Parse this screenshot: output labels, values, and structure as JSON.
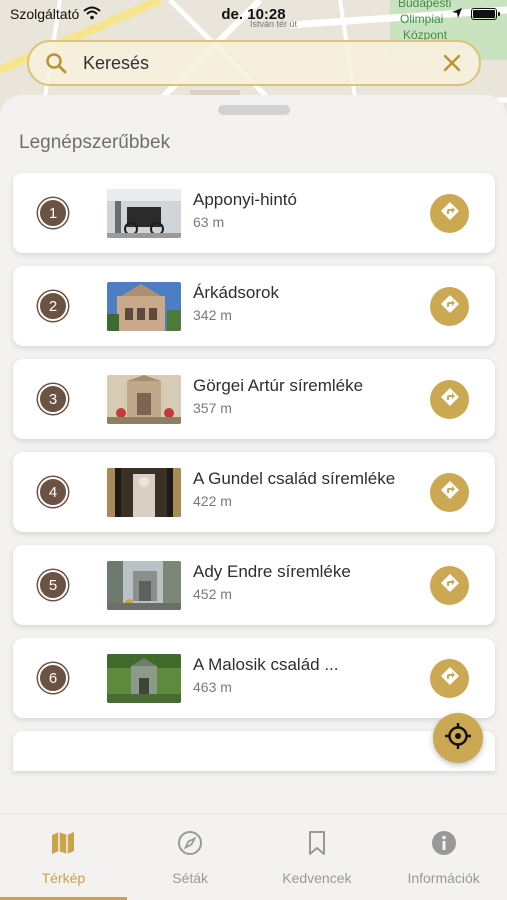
{
  "status_bar": {
    "carrier": "Szolgáltató",
    "time": "de. 10:28",
    "icons": [
      "wifi-icon",
      "location-arrow-icon",
      "battery-icon"
    ]
  },
  "map": {
    "labels": [
      "Budapesti",
      "Olimpiai",
      "Központ",
      "István tér út"
    ]
  },
  "search": {
    "placeholder": "Keresés",
    "icons": [
      "search-icon",
      "clear-icon"
    ]
  },
  "section": {
    "title": "Legnépszerűbbek"
  },
  "places": [
    {
      "rank": "1",
      "name": "Apponyi-hintó",
      "distance": "63 m"
    },
    {
      "rank": "2",
      "name": "Árkádsorok",
      "distance": "342 m"
    },
    {
      "rank": "3",
      "name": "Görgei Artúr síremléke",
      "distance": "357 m"
    },
    {
      "rank": "4",
      "name": "A Gundel család síremléke",
      "distance": "422 m"
    },
    {
      "rank": "5",
      "name": "Ady Endre síremléke",
      "distance": "452 m"
    },
    {
      "rank": "6",
      "name": "A Malosik család ...",
      "distance": "463 m"
    }
  ],
  "tabs": [
    {
      "label": "Térkép",
      "icon": "map-icon",
      "active": true
    },
    {
      "label": "Séták",
      "icon": "compass-icon",
      "active": false
    },
    {
      "label": "Kedvencek",
      "icon": "bookmark-icon",
      "active": false
    },
    {
      "label": "Információk",
      "icon": "info-icon",
      "active": false
    }
  ],
  "colors": {
    "accent": "#cba952",
    "tab_active": "#c8a44a",
    "rank_badge": "#6b5242"
  }
}
